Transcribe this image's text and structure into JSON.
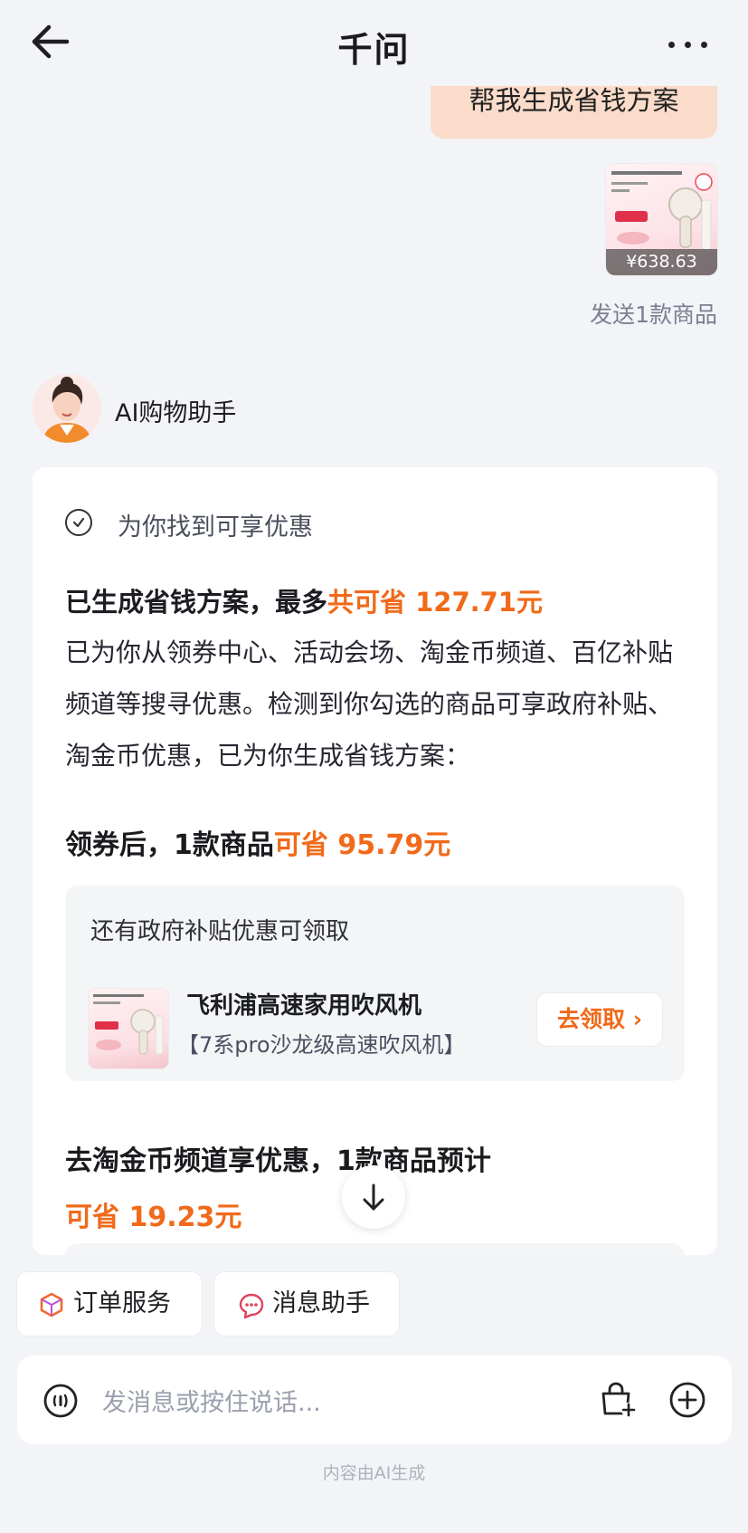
{
  "header": {
    "title": "千问"
  },
  "user_message": {
    "text": "帮我生成省钱方案",
    "product_price": "¥638.63",
    "sent_note": "发送1款商品"
  },
  "assistant": {
    "name": "AI购物助手",
    "status": "为你找到可享优惠",
    "plan_title_prefix": "已生成省钱方案，最多",
    "plan_title_highlight": "共可省 127.71元",
    "paragraph": "已为你从领券中心、活动会场、淘金币频道、百亿补贴频道等搜寻优惠。检测到你勾选的商品可享政府补贴、淘金币优惠，已为你生成省钱方案：",
    "section1_prefix": "领券后，1款商品",
    "section1_highlight": "可省 95.79元",
    "subsidy": {
      "note": "还有政府补贴优惠可领取",
      "product_name": "飞利浦高速家用吹风机",
      "product_sub": "【7系pro沙龙级高速吹风机】",
      "claim_label": "去领取 ›"
    },
    "section2_text": "去淘金币频道享优惠，1款商品预计",
    "section2_highlight": "可省 19.23元"
  },
  "chips": [
    {
      "label": "订单服务",
      "icon": "cube-icon"
    },
    {
      "label": "消息助手",
      "icon": "chat-bubble-icon"
    }
  ],
  "input": {
    "placeholder": "发消息或按住说话..."
  },
  "footer": "内容由AI生成",
  "colors": {
    "accent": "#f06a1a",
    "bubble": "#fbdcca",
    "background": "#f3f4f7"
  }
}
